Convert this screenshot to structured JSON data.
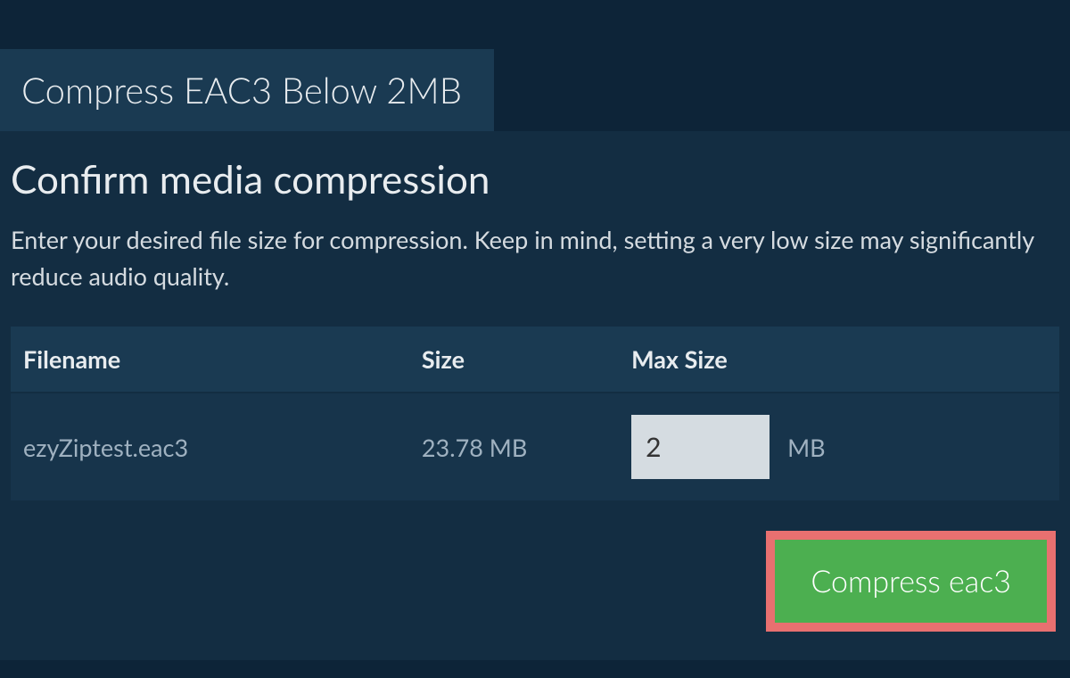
{
  "tab": {
    "label": "Compress EAC3 Below 2MB"
  },
  "heading": "Confirm media compression",
  "description": "Enter your desired file size for compression. Keep in mind, setting a very low size may significantly reduce audio quality.",
  "table": {
    "columns": {
      "filename": "Filename",
      "size": "Size",
      "maxsize": "Max Size"
    },
    "rows": [
      {
        "filename": "ezyZiptest.eac3",
        "size": "23.78 MB",
        "max_size_value": "2",
        "max_size_unit": "MB"
      }
    ]
  },
  "actions": {
    "compress_label": "Compress eac3"
  }
}
